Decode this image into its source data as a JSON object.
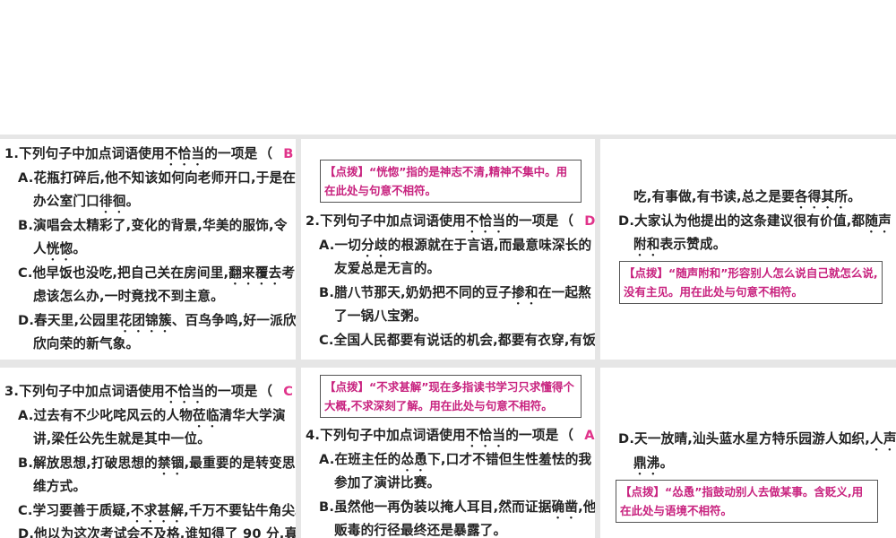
{
  "answer_open": "（",
  "answer_close": "）",
  "panels": [
    {
      "items": [
        {
          "type": "question",
          "pre": "1.下列句子中加点词语使用",
          "em": "不恰当",
          "post": "的一项是",
          "answer": "B"
        },
        {
          "type": "option",
          "pre": "A.花瓶打碎后,他不知该如何向老师开口,于是在",
          "em": "",
          "post": ""
        },
        {
          "type": "cont",
          "pre": "办公室门口",
          "em": "徘徊",
          "post": "。"
        },
        {
          "type": "option",
          "pre": "B.演唱会太精彩了,变化的背景,华美的服饰,令",
          "em": "",
          "post": ""
        },
        {
          "type": "cont",
          "pre": "人",
          "em": "恍惚",
          "post": "。"
        },
        {
          "type": "option",
          "pre": "C.他早饭也没吃,把自己关在房间里,",
          "em": "翻来覆去",
          "post": "考"
        },
        {
          "type": "cont",
          "pre": "虑该怎么办,一时竟找不到主意。",
          "em": "",
          "post": ""
        },
        {
          "type": "option",
          "pre": "D.春天里,公园里",
          "em": "花团锦簇",
          "post": "、百鸟争鸣,好一派欣"
        },
        {
          "type": "cont",
          "pre": "欣向荣的新气象。",
          "em": "",
          "post": ""
        }
      ]
    },
    {
      "items": [
        {
          "type": "note",
          "text": "【点拨】“恍惚”指的是神志不清,精神不集中。用在此处与句意不相符。"
        },
        {
          "type": "question",
          "pre": "2.下列句子中加点词语使用",
          "em": "不恰当",
          "post": "的一项是",
          "answer": "D"
        },
        {
          "type": "option",
          "pre": "A.一切",
          "em": "分歧",
          "post": "的根源就在于言语,而最意味深长的"
        },
        {
          "type": "cont",
          "pre": "友爱总是无言的。",
          "em": "",
          "post": ""
        },
        {
          "type": "option",
          "pre": "B.腊八节那天,奶奶把不同的豆子",
          "em": "掺和",
          "post": "在一起熬"
        },
        {
          "type": "cont",
          "pre": "了一锅八宝粥。",
          "em": "",
          "post": ""
        },
        {
          "type": "option",
          "pre": "C.全国人民都要有说话的机会,都要有衣穿,有饭",
          "em": "",
          "post": ""
        }
      ]
    },
    {
      "items": [
        {
          "type": "cont",
          "pre": "吃,有事做,有书读,总之是要",
          "em": "各得其所",
          "post": "。"
        },
        {
          "type": "option",
          "pre": "D.大家认为他提出的这条建议很有价值,都",
          "em": "随声",
          "post": ""
        },
        {
          "type": "cont",
          "pre": "",
          "em": "附和",
          "post": "表示赞成。"
        },
        {
          "type": "note",
          "text": "【点拨】“随声附和”形容别人怎么说自己就怎么说,没有主见。用在此处与句意不相符。"
        }
      ]
    },
    {
      "items": [
        {
          "type": "question",
          "pre": "3.下列句子中加点词语使用",
          "em": "不恰当",
          "post": "的一项是",
          "answer": "C"
        },
        {
          "type": "option",
          "pre": "A.过去有不少叱咤风云的人物",
          "em": "莅临",
          "post": "清华大学演"
        },
        {
          "type": "cont",
          "pre": "讲,梁任公先生就是其中一位。",
          "em": "",
          "post": ""
        },
        {
          "type": "option",
          "pre": "B.解放思想,打破思想的",
          "em": "禁锢",
          "post": ",最重要的是转变思"
        },
        {
          "type": "cont",
          "pre": "维方式。",
          "em": "",
          "post": ""
        },
        {
          "type": "option",
          "pre": "C.学习要善于质疑,",
          "em": "不求甚解",
          "post": ",千万不要钻牛角尖。"
        },
        {
          "type": "option",
          "pre": "D.他以为这次考试会不及格,谁知得了 90 分,真",
          "em": "",
          "post": ""
        }
      ]
    },
    {
      "items": [
        {
          "type": "note",
          "text": "【点拨】“不求甚解”现在多指读书学习只求懂得个大概,不求深刻了解。用在此处与句意不相符。"
        },
        {
          "type": "question",
          "pre": "4.下列句子中加点词语使用",
          "em": "不恰当",
          "post": "的一项是",
          "answer": "A"
        },
        {
          "type": "option",
          "pre": "A.在班主任的",
          "em": "怂恿",
          "post": "下,口才不错但生性羞怯的我"
        },
        {
          "type": "cont",
          "pre": "参加了演讲比赛。",
          "em": "",
          "post": ""
        },
        {
          "type": "option",
          "pre": "B.虽然他一再伪装以掩人耳目,然而证据",
          "em": "确凿",
          "post": ",他"
        },
        {
          "type": "cont",
          "pre": "贩毒的行径最终还是暴露了。",
          "em": "",
          "post": ""
        }
      ]
    },
    {
      "items": [
        {
          "type": "option",
          "pre": "D.天一放晴,汕头蓝水星方特乐园游人如织,",
          "em": "人声",
          "post": ""
        },
        {
          "type": "cont",
          "pre": "",
          "em": "鼎沸",
          "post": "。"
        },
        {
          "type": "note",
          "text": "【点拨】“怂恿”指鼓动别人去做某事。含贬义,用在此处与语境不相符。"
        }
      ]
    }
  ]
}
